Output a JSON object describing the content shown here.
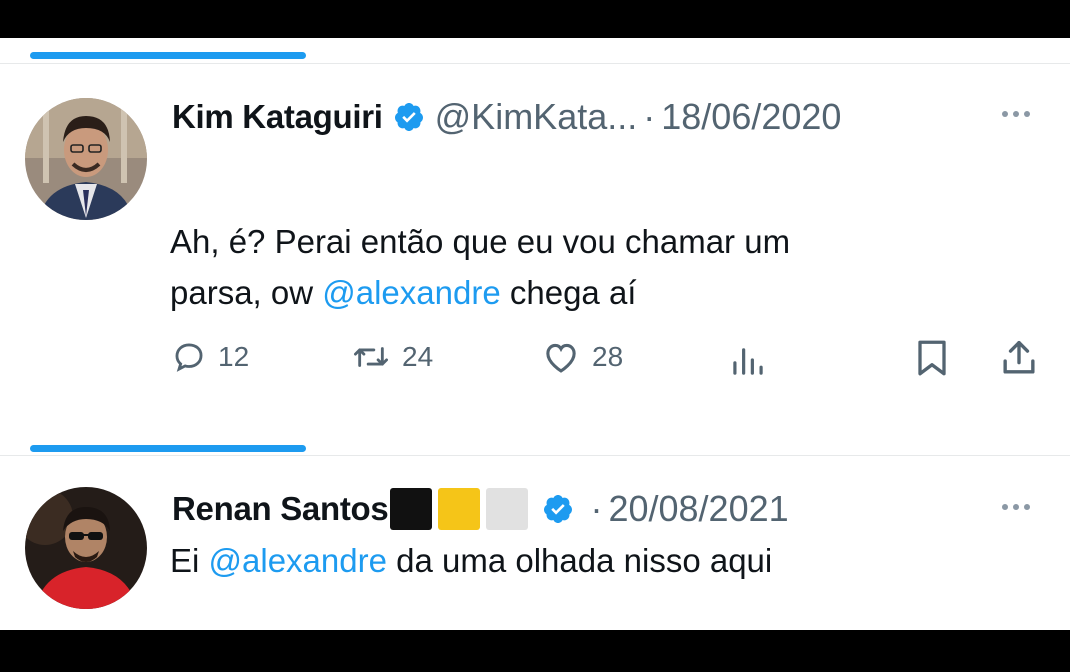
{
  "tweets": [
    {
      "author_name": "Kim Kataguiri",
      "handle": "@KimKata...",
      "separator": "·",
      "date": "18/06/2020",
      "text_parts": [
        "Ah, é? Perai então que eu vou chamar um",
        "parsa, ow ",
        "@alexandre",
        " chega aí"
      ],
      "actions": {
        "replies": "12",
        "retweets": "24",
        "likes": "28"
      },
      "icons": [
        "verified-badge-icon",
        "more-options-icon",
        "reply-icon",
        "retweet-icon",
        "like-icon",
        "views-icon",
        "bookmark-icon",
        "share-icon"
      ]
    },
    {
      "author_name": "Renan Santos",
      "separator": "·",
      "date": "20/08/2021",
      "text_parts": [
        "Ei ",
        "@alexandre",
        " da uma olhada nisso aqui"
      ],
      "name_emoji_colors": [
        "#111111",
        "#f5c518",
        "#e1e1e1"
      ],
      "icons": [
        "verified-badge-icon",
        "more-options-icon"
      ]
    }
  ],
  "colors": {
    "accent": "#1d9bf0",
    "text": "#0f1419",
    "muted": "#536471",
    "background": "#ffffff"
  }
}
